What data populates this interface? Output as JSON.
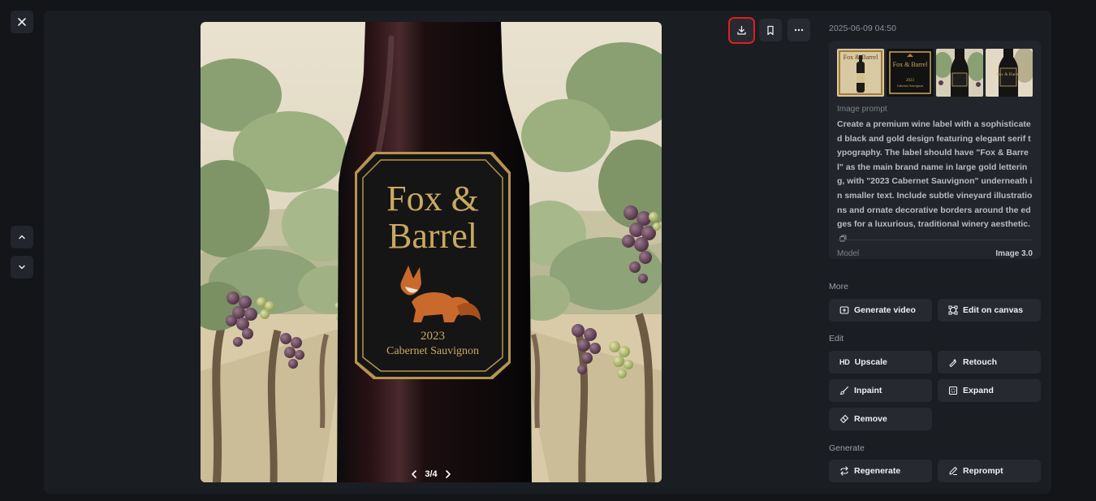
{
  "viewer": {
    "close_icon": "close-icon",
    "nav_prev_icon": "chevron-up-icon",
    "nav_next_icon": "chevron-down-icon",
    "pager": {
      "text": "3/4"
    },
    "image_label": {
      "brand": "Fox & Barrel",
      "brand_line1": "Fox &",
      "brand_line2": "Barrel",
      "year": "2023",
      "variety": "Cabernet Sauvignon"
    }
  },
  "toolbar": {
    "download_icon": "download-icon",
    "bookmark_icon": "bookmark-icon",
    "more_icon": "more-icon"
  },
  "details": {
    "timestamp": "2025-06-09 04:50",
    "thumbnails": [
      {
        "label_line1": "Fox & Barrel"
      },
      {
        "label_line1": "Fox & Barrel",
        "label_line2": "2023",
        "label_line3": "Cabernet Sauvignon"
      },
      {
        "label_line1": ""
      },
      {
        "label_line1": "Fox & Barrel"
      }
    ],
    "prompt_label": "Image prompt",
    "prompt_text": "Create a premium wine label with a sophisticated black and gold design featuring elegant serif typography. The label should have \"Fox & Barrel\" as the main brand name in large gold lettering, with \"2023 Cabernet Sauvignon\" underneath in smaller text. Include subtle vineyard illustrations and ornate decorative borders around the edges for a luxurious, traditional winery aesthetic.",
    "model_label": "Model",
    "model_value": "Image 3.0"
  },
  "sections": {
    "more": {
      "title": "More",
      "generate_video": "Generate video",
      "edit_on_canvas": "Edit on canvas"
    },
    "edit": {
      "title": "Edit",
      "upscale": "Upscale",
      "upscale_badge": "HD",
      "retouch": "Retouch",
      "inpaint": "Inpaint",
      "expand": "Expand",
      "remove": "Remove"
    },
    "generate": {
      "title": "Generate",
      "regenerate": "Regenerate",
      "reprompt": "Reprompt"
    }
  },
  "colors": {
    "background": "#131519",
    "panel": "#1a1d22",
    "highlight": "#e11d22",
    "gold": "#c9a961"
  }
}
